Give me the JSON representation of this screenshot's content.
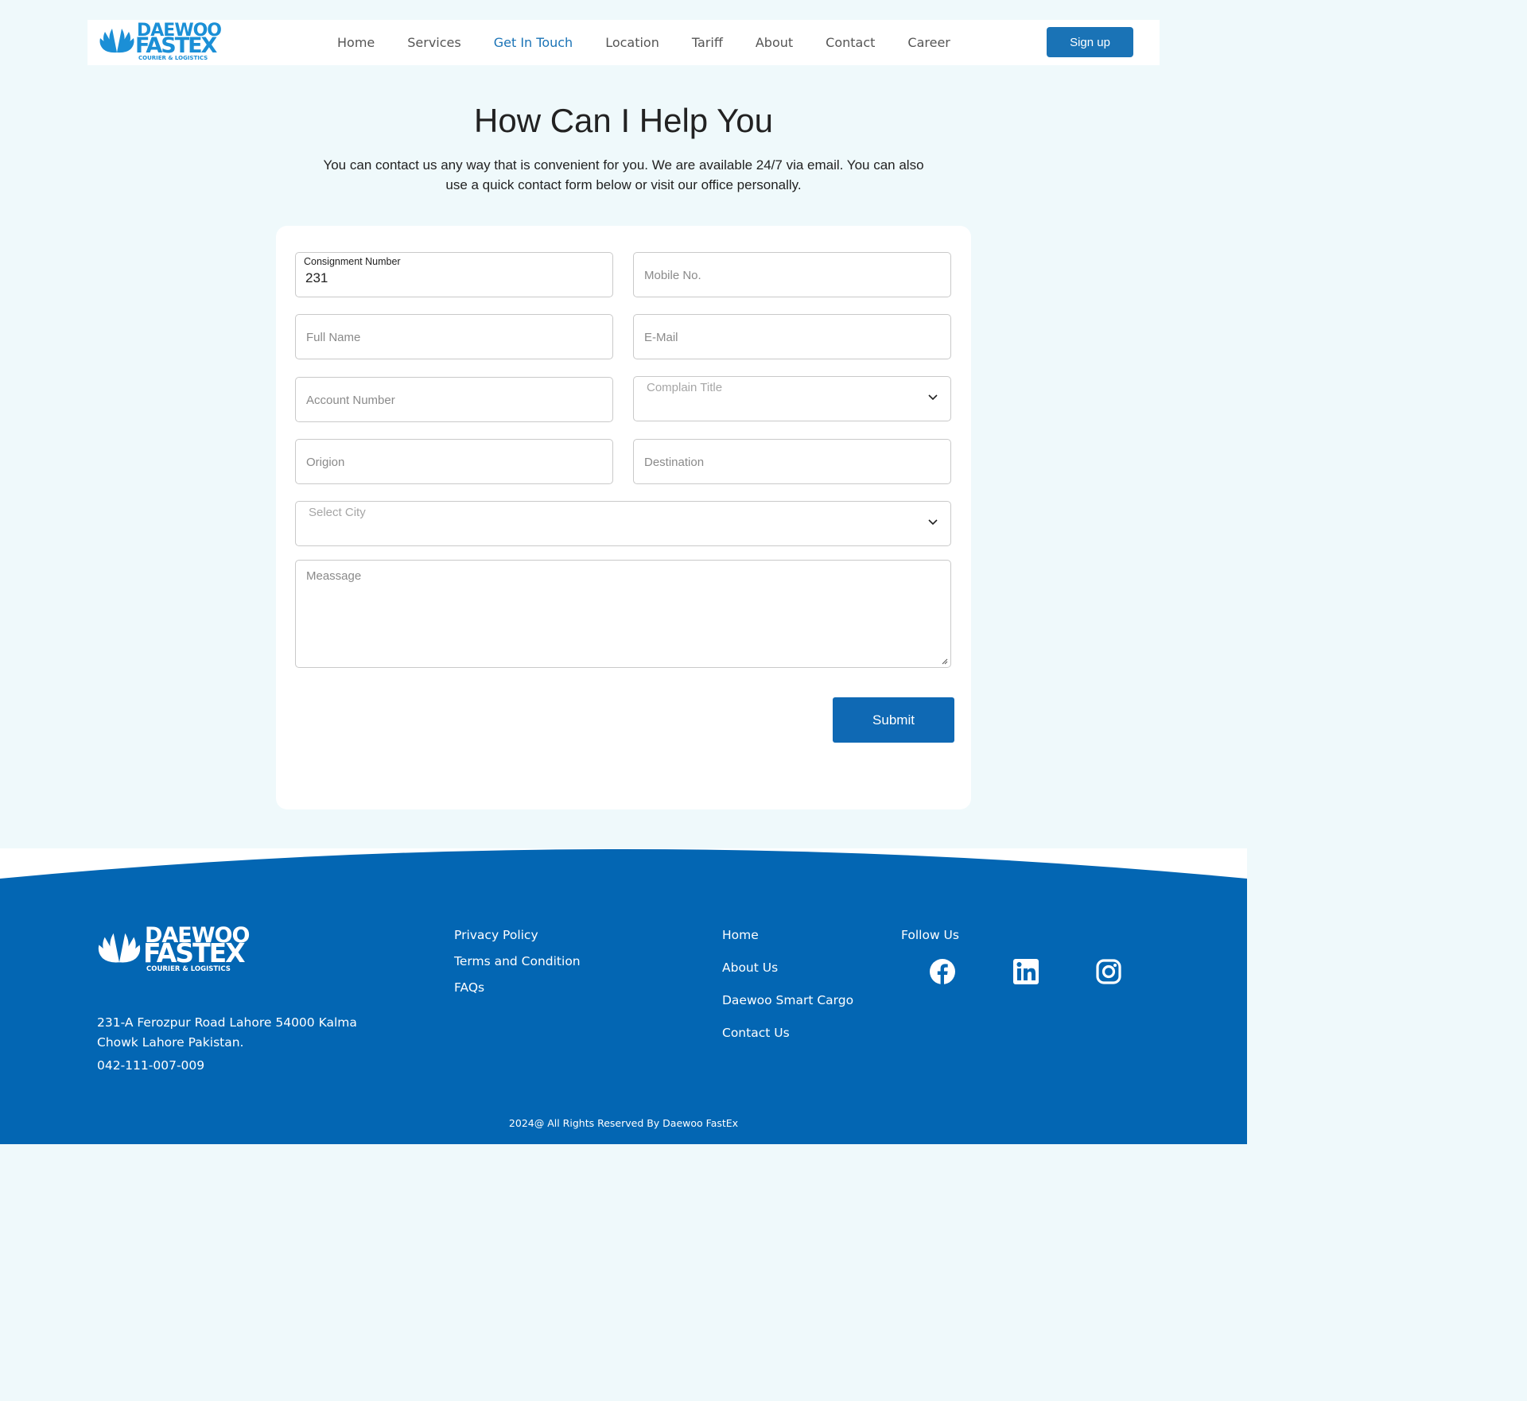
{
  "header": {
    "logo": {
      "word1": "DAEWOO",
      "word2": "FASTEX",
      "tagline": "COURIER & LOGISTICS"
    },
    "nav": [
      "Home",
      "Services",
      "Get In Touch",
      "Location",
      "Tariff",
      "About",
      "Contact",
      "Career"
    ],
    "active_nav": "Get In Touch",
    "signup_label": "Sign up"
  },
  "hero": {
    "title": "How Can I Help You",
    "intro": "You can contact us any way that is convenient for you. We are available 24/7 via email. You can also use a quick contact form below or visit our office personally."
  },
  "form": {
    "consignment": {
      "label": "Consignment Number",
      "value": "231"
    },
    "mobile": {
      "placeholder": "Mobile No."
    },
    "full_name": {
      "placeholder": "Full Name"
    },
    "email": {
      "placeholder": "E-Mail"
    },
    "account": {
      "placeholder": "Account Number"
    },
    "complain_title": {
      "placeholder": "Complain Title"
    },
    "origin": {
      "placeholder": "Origion"
    },
    "destination": {
      "placeholder": "Destination"
    },
    "city": {
      "placeholder": "Select City"
    },
    "message": {
      "placeholder": "Meassage"
    },
    "submit_label": "Submit"
  },
  "footer": {
    "logo": {
      "word1": "DAEWOO",
      "word2": "FASTEX",
      "tagline": "COURIER & LOGISTICS"
    },
    "address": "231-A Ferozpur Road Lahore 54000 Kalma Chowk Lahore Pakistan.",
    "phone": "042-111-007-009",
    "links1": [
      "Privacy Policy",
      "Terms and Condition",
      "FAQs"
    ],
    "links2": [
      "Home",
      "About Us",
      "Daewoo Smart Cargo",
      "Contact Us"
    ],
    "follow_label": "Follow Us",
    "social_icons": [
      "facebook-icon",
      "linkedin-icon",
      "instagram-icon"
    ],
    "copyright": "2024@ All Rights Reserved By Daewoo FastEx"
  },
  "colors": {
    "page_bg": "#eff9fb",
    "brand_blue": "#1a73b6",
    "footer_blue": "#0366b3",
    "logo_blue": "#1b8fd6"
  }
}
